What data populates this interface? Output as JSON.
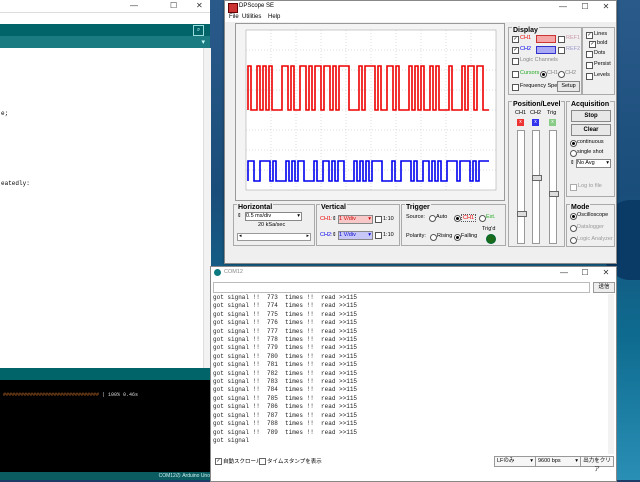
{
  "ide": {
    "editor_fragments": [
      "e;",
      "eatedly:"
    ],
    "console_hashes": "################################",
    "console_progress": "| 100% 0.46s",
    "status": "COM12の Arduino Uno"
  },
  "dpscope": {
    "title": "DPScope SE",
    "menu": [
      "File",
      "Utilities",
      "Help"
    ],
    "display": {
      "title": "Display",
      "ch1": "CH1",
      "ch2": "CH2",
      "ref1": "REF1",
      "ref2": "REF2",
      "logic_channels": "Logic Channels",
      "cursors": "Cursors",
      "cursor_ch1": "CH1",
      "cursor_ch2": "CH2",
      "frequency_spectrum": "Frequency Spectrum",
      "setup": "Setup",
      "lines": "Lines",
      "bold": "bold",
      "dots": "Dots",
      "persist": "Persist",
      "levels": "Levels"
    },
    "position_level": {
      "title": "Position/Level",
      "ch1": "CH1",
      "ch2": "CH2",
      "trig": "Trig"
    },
    "acquisition": {
      "title": "Acquisition",
      "stop": "Stop",
      "clear": "Clear",
      "continuous": "continuous",
      "single_shot": "single shot",
      "avg": "No Avg",
      "log_to_file": "Log to file"
    },
    "mode": {
      "title": "Mode",
      "oscilloscope": "Oscilloscope",
      "datalogger": "Datalogger",
      "logic_analyzer": "Logic Analyzer"
    },
    "horizontal": {
      "title": "Horizontal",
      "timebase": "0.5 ms/div",
      "rate": "20 kSa/sec"
    },
    "vertical": {
      "title": "Vertical",
      "ch1_label": "CH1:",
      "ch1_value": "1 V/div",
      "ch2_label": "CH2:",
      "ch2_value": "1 V/div",
      "x10": "1:10"
    },
    "trigger": {
      "title": "Trigger",
      "source_label": "Source:",
      "auto": "Auto",
      "ch1": "CH1",
      "ext": "Ext.",
      "polarity_label": "Polarity:",
      "rising": "Rising",
      "falling": "Falling",
      "trigd": "Trig'd"
    },
    "colors": {
      "ch1": "#ee0000",
      "ch2": "#0000ee"
    }
  },
  "serial_monitor": {
    "title": "COM12",
    "send": "送信",
    "lines": [
      "got signal !!  773  times !!  read >>115",
      "got signal !!  774  times !!  read >>115",
      "got signal !!  775  times !!  read >>115",
      "got signal !!  776  times !!  read >>115",
      "got signal !!  777  times !!  read >>115",
      "got signal !!  778  times !!  read >>115",
      "got signal !!  779  times !!  read >>115",
      "got signal !!  780  times !!  read >>115",
      "got signal !!  781  times !!  read >>115",
      "got signal !!  782  times !!  read >>115",
      "got signal !!  783  times !!  read >>115",
      "got signal !!  784  times !!  read >>115",
      "got signal !!  785  times !!  read >>115",
      "got signal !!  786  times !!  read >>115",
      "got signal !!  787  times !!  read >>115",
      "got signal !!  788  times !!  read >>115",
      "got signal !!  789  times !!  read >>115",
      "got signal"
    ],
    "autoscroll": "自動スクロール",
    "timestamp": "タイムスタンプを表示",
    "line_ending": "LFのみ",
    "baud": "9600 bps",
    "clear": "出力をクリア"
  }
}
